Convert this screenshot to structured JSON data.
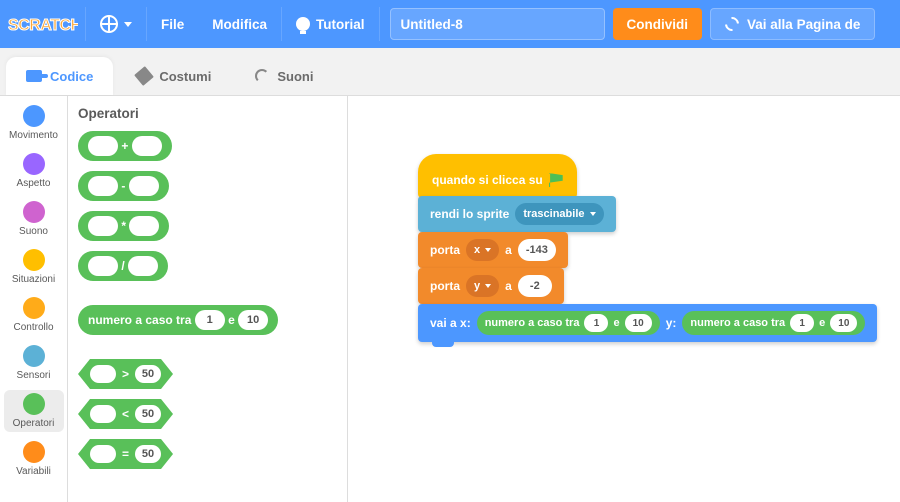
{
  "menubar": {
    "file": "File",
    "edit": "Modifica",
    "tutorials": "Tutorial",
    "project_title": "Untitled-8",
    "share": "Condividi",
    "community": "Vai alla Pagina de"
  },
  "tabs": {
    "code": "Codice",
    "costumes": "Costumi",
    "sounds": "Suoni"
  },
  "categories": [
    {
      "label": "Movimento",
      "color": "#4c97ff"
    },
    {
      "label": "Aspetto",
      "color": "#9966ff"
    },
    {
      "label": "Suono",
      "color": "#cf63cf"
    },
    {
      "label": "Situazioni",
      "color": "#ffbf00"
    },
    {
      "label": "Controllo",
      "color": "#ffab19"
    },
    {
      "label": "Sensori",
      "color": "#5cb1d6"
    },
    {
      "label": "Operatori",
      "color": "#59c059",
      "selected": true
    },
    {
      "label": "Variabili",
      "color": "#ff8c1a"
    }
  ],
  "palette": {
    "heading": "Operatori",
    "ops": {
      "add": "+",
      "sub": "-",
      "mul": "*",
      "div": "/"
    },
    "random": {
      "label_pre": "numero a caso tra",
      "a": "1",
      "label_mid": "e",
      "b": "10"
    },
    "compare": {
      "gt": ">",
      "lt": "<",
      "eq": "=",
      "val": "50"
    }
  },
  "script": {
    "hat": "quando si clicca su",
    "sensing": {
      "label": "rendi lo sprite",
      "mode": "trascinabile"
    },
    "set1": {
      "label": "porta",
      "var": "x",
      "to": "a",
      "val": "-143"
    },
    "set2": {
      "label": "porta",
      "var": "y",
      "to": "a",
      "val": "-2"
    },
    "goto": {
      "label": "vai a x:",
      "ylabel": "y:",
      "rand": {
        "pre": "numero a caso tra",
        "a": "1",
        "mid": "e",
        "b": "10"
      }
    }
  }
}
